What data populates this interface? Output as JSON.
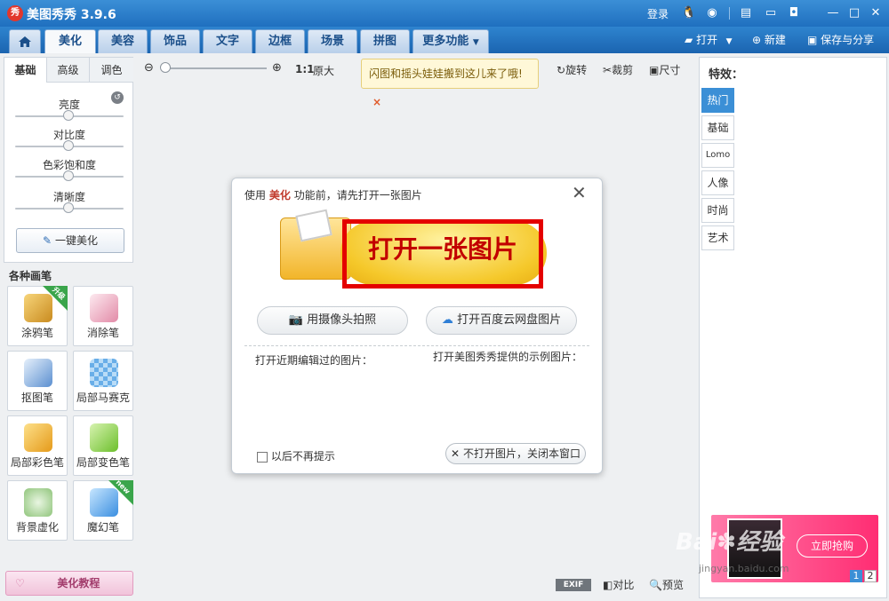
{
  "app": {
    "logo_text": "秀",
    "title": "美图秀秀 3.9.6"
  },
  "titlebar": {
    "login": "登录"
  },
  "nav": {
    "tabs": [
      "美化",
      "美容",
      "饰品",
      "文字",
      "边框",
      "场景",
      "拼图",
      "更多功能"
    ],
    "open": "打开",
    "new": "新建",
    "save": "保存与分享"
  },
  "left": {
    "subtabs": [
      "基础",
      "高级",
      "调色"
    ],
    "sliders": [
      "亮度",
      "对比度",
      "色彩饱和度",
      "清晰度"
    ],
    "onekey": "一键美化",
    "brush_title": "各种画笔",
    "brushes": [
      "涂鸦笔",
      "消除笔",
      "抠图笔",
      "局部马赛克",
      "局部彩色笔",
      "局部变色笔",
      "背景虚化",
      "魔幻笔"
    ],
    "badges": {
      "upgrade": "升级",
      "new": "new"
    },
    "tutorial": "美化教程"
  },
  "toolbar": {
    "ratio": "1:1",
    "original": "原大",
    "rotate": "旋转",
    "crop": "裁剪",
    "size": "尺寸"
  },
  "tip": {
    "text": "闪图和摇头娃娃搬到这儿来了哦!",
    "close": "×"
  },
  "dialog": {
    "prefix": "使用",
    "highlight": "美化",
    "suffix": "功能前，请先打开一张图片",
    "open_label": "打开一张图片",
    "camera": "用摄像头拍照",
    "cloud": "打开百度云网盘图片",
    "recent": "打开近期编辑过的图片：",
    "samples": "打开美图秀秀提供的示例图片：",
    "no_prompt": "以后不再提示",
    "close_window": "不打开图片，关闭本窗口"
  },
  "right": {
    "title": "特效：",
    "tabs": [
      "热门",
      "基础",
      "Lomo",
      "人像",
      "时尚",
      "艺术"
    ],
    "ad_button": "立即抢购",
    "pages": [
      "1",
      "2"
    ]
  },
  "bottom": {
    "exif": "EXIF",
    "compare": "对比",
    "preview": "预览"
  },
  "watermark": {
    "brand": "Bai",
    "suffix": "经验",
    "url": "jingyan.baidu.com"
  },
  "colors": {
    "accent": "#1f6fbf",
    "highlight": "#e40000",
    "dialog_keyword": "#c0392b"
  }
}
